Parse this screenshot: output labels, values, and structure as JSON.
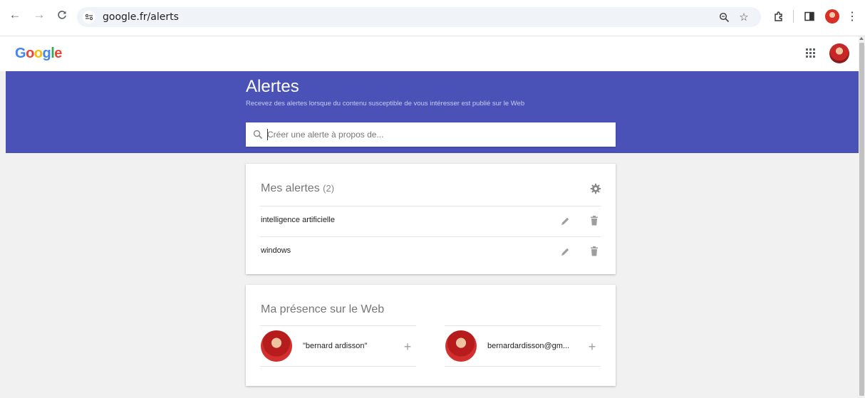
{
  "browser": {
    "url": "google.fr/alerts"
  },
  "header": {
    "logo": [
      "G",
      "o",
      "o",
      "g",
      "l",
      "e"
    ],
    "logo_colors": [
      "#4285f4",
      "#ea4335",
      "#fbbc05",
      "#4285f4",
      "#34a853",
      "#ea4335"
    ]
  },
  "banner": {
    "title": "Alertes",
    "subtitle": "Recevez des alertes lorsque du contenu susceptible de vous intéresser est publié sur le Web",
    "search_placeholder": "Créer une alerte à propos de...",
    "color": "#4a52b8"
  },
  "my_alerts": {
    "title": "Mes alertes",
    "count": "(2)",
    "items": [
      {
        "label": "intelligence artificielle"
      },
      {
        "label": "windows"
      }
    ]
  },
  "presence": {
    "title": "Ma présence sur le Web",
    "items": [
      {
        "label": "\"bernard ardisson\""
      },
      {
        "label": "bernardardisson@gm..."
      }
    ]
  }
}
